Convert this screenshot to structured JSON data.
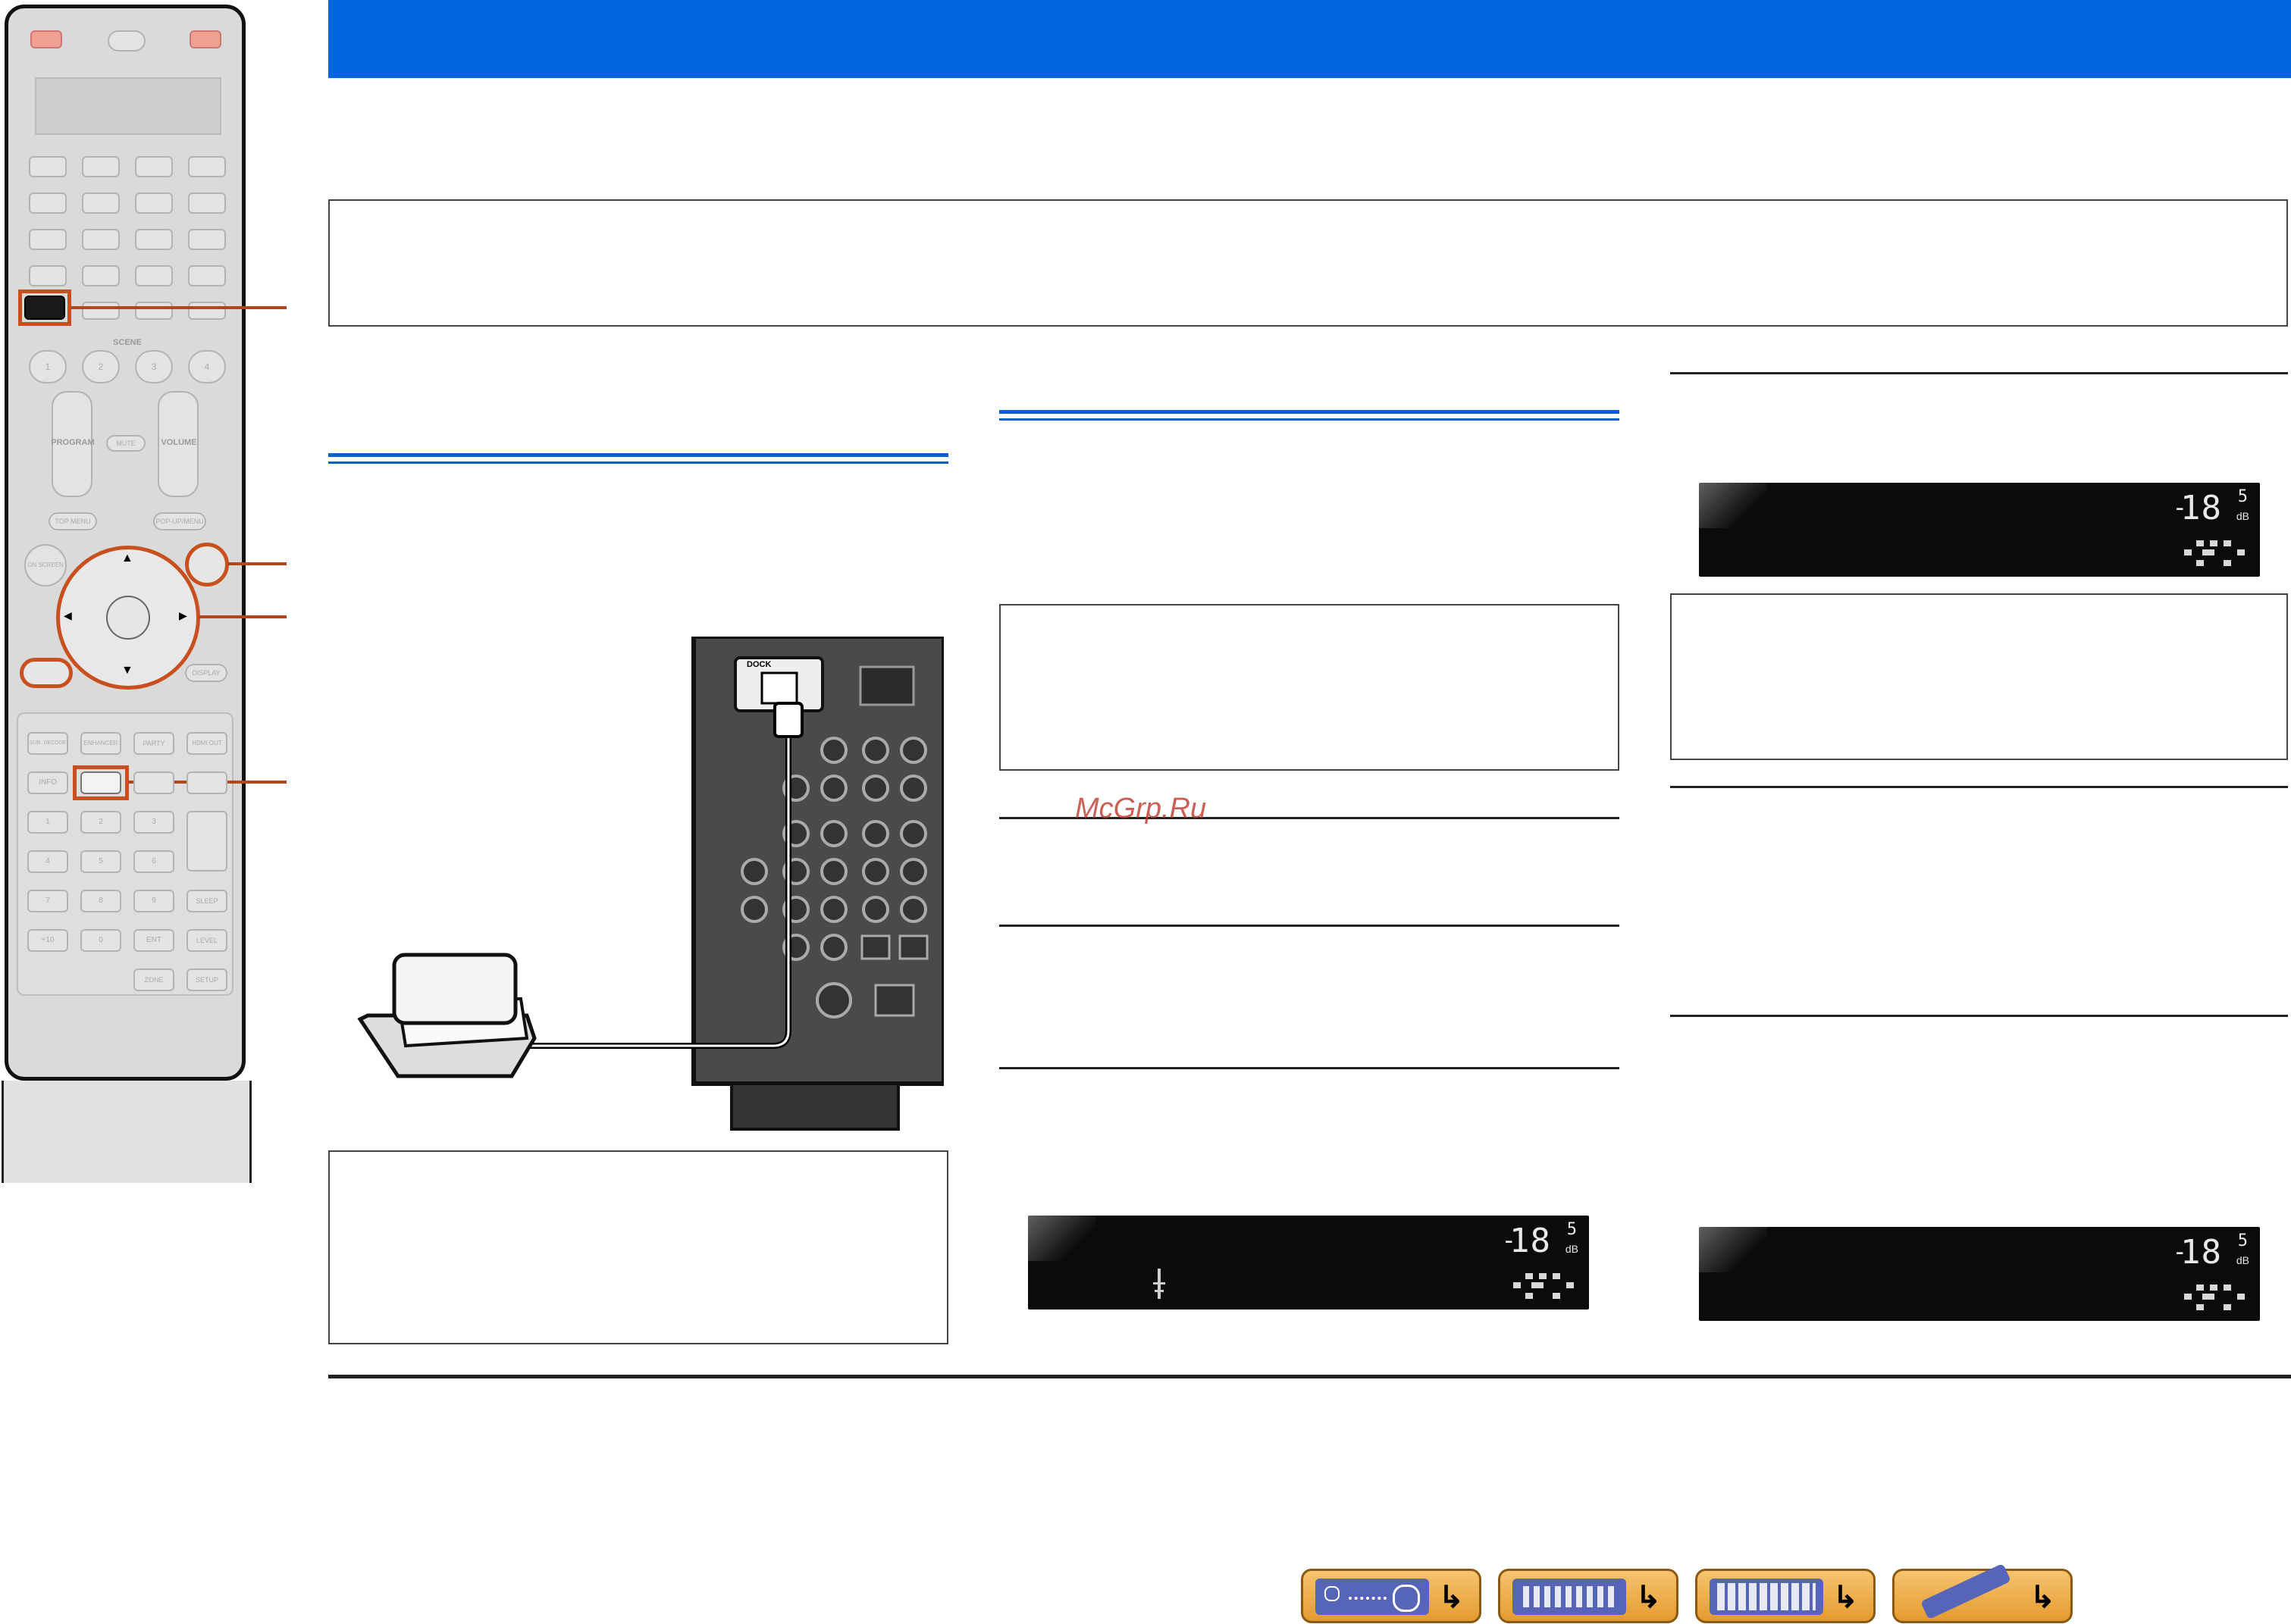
{
  "remote": {
    "scene_label": "SCENE",
    "scene_buttons": [
      "1",
      "2",
      "3",
      "4"
    ],
    "program_label": "PROGRAM",
    "mute_label": "MUTE",
    "volume_label": "VOLUME",
    "top_menu": "TOP MENU",
    "popup_menu": "POP-UP/MENU",
    "on_screen": "ON SCREEN",
    "display": "DISPLAY",
    "row_a": [
      "SUR. DECODE",
      "ENHANCER",
      "PARTY",
      "HDMI OUT"
    ],
    "info": "INFO",
    "numbers": [
      "1",
      "2",
      "3",
      "4",
      "5",
      "6",
      "7",
      "8",
      "9",
      "+10",
      "0",
      "ENT"
    ],
    "sleep": "SLEEP",
    "level": "LEVEL",
    "zone": "ZONE",
    "setup": "SETUP"
  },
  "receiver": {
    "dock_label": "DOCK"
  },
  "displays": [
    {
      "minus": "-",
      "volume": "18",
      "decimal": "5",
      "unit": "dB"
    },
    {
      "minus": "-",
      "volume": "18",
      "decimal": "5",
      "unit": "dB"
    },
    {
      "minus": "-",
      "volume": "18",
      "decimal": "5",
      "unit": "dB"
    }
  ],
  "watermark": "McGrp.Ru",
  "nav": {
    "icons": [
      "front-panel-icon",
      "rear-panel-icon",
      "display-panel-icon",
      "remote-control-icon"
    ],
    "arrow": "↳"
  }
}
